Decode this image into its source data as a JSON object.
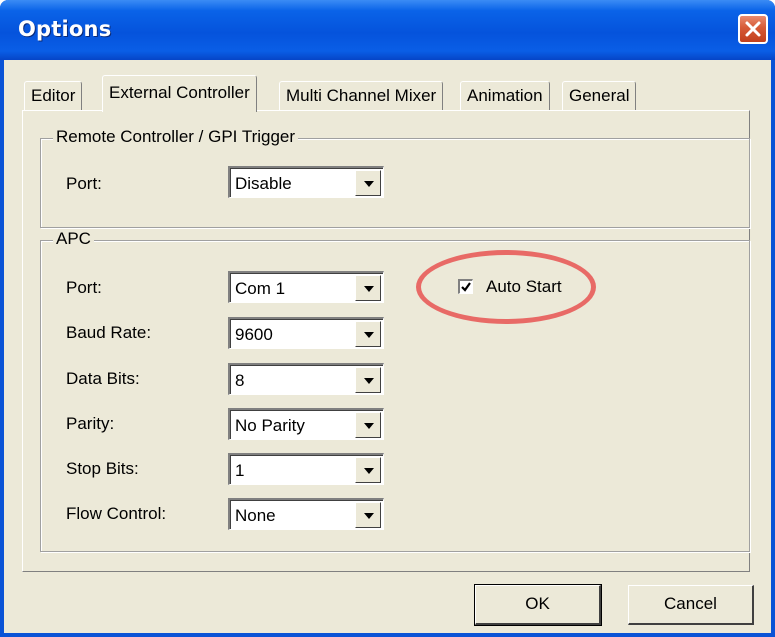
{
  "window": {
    "title": "Options"
  },
  "tabs": [
    {
      "label": "Editor"
    },
    {
      "label": "External Controller"
    },
    {
      "label": "Multi Channel Mixer"
    },
    {
      "label": "Animation"
    },
    {
      "label": "General"
    }
  ],
  "active_tab": "External Controller",
  "remote_group": {
    "title": "Remote Controller / GPI Trigger",
    "port_label": "Port:",
    "port_value": "Disable"
  },
  "apc_group": {
    "title": "APC",
    "fields": [
      {
        "label": "Port:",
        "value": "Com 1"
      },
      {
        "label": "Baud Rate:",
        "value": "9600"
      },
      {
        "label": "Data Bits:",
        "value": "8"
      },
      {
        "label": "Parity:",
        "value": "No Parity"
      },
      {
        "label": "Stop Bits:",
        "value": "1"
      },
      {
        "label": "Flow Control:",
        "value": "None"
      }
    ],
    "auto_start": {
      "label": "Auto Start",
      "checked": true
    }
  },
  "buttons": {
    "ok": "OK",
    "cancel": "Cancel"
  },
  "colors": {
    "titlebar": "#0553dc",
    "dialog_face": "#ece9d8",
    "highlight": "#e86a66",
    "close_button": "#d65a37"
  },
  "icons": [
    "close-icon",
    "dropdown-arrow-icon",
    "checkmark-icon"
  ]
}
